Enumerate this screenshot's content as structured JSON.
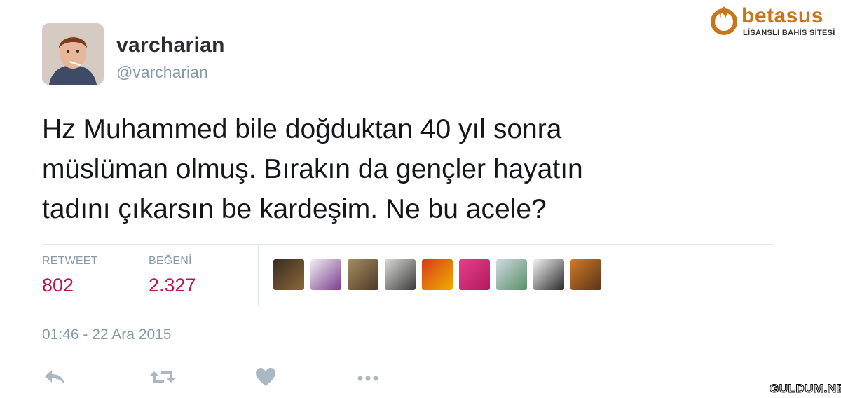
{
  "user": {
    "display_name": "varcharian",
    "handle": "@varcharian"
  },
  "tweet": {
    "lines": [
      "Hz Muhammed bile doğduktan 40 yıl sonra",
      "müslüman olmuş. Bırakın da gençler hayatın",
      "tadını çıkarsın be kardeşim. Ne bu acele?"
    ],
    "timestamp": "01:46 - 22 Ara 2015"
  },
  "stats": {
    "retweet_label": "RETWEET",
    "retweet_count": "802",
    "like_label": "BEĞENİ",
    "like_count": "2.327"
  },
  "likers": [
    {
      "name": "liker-avatar-1",
      "colors": [
        "#3a2b1f",
        "#8a6a3c"
      ]
    },
    {
      "name": "liker-avatar-2",
      "colors": [
        "#f1eff2",
        "#7a3b8c"
      ]
    },
    {
      "name": "liker-avatar-3",
      "colors": [
        "#a58c62",
        "#4d3a26"
      ]
    },
    {
      "name": "liker-avatar-4",
      "colors": [
        "#d9d9d4",
        "#3c3c3a"
      ]
    },
    {
      "name": "liker-avatar-5",
      "colors": [
        "#d63a1a",
        "#f0b000"
      ]
    },
    {
      "name": "liker-avatar-6",
      "colors": [
        "#e83e8c",
        "#b11a5c"
      ]
    },
    {
      "name": "liker-avatar-7",
      "colors": [
        "#cfd9de",
        "#5a8f6a"
      ]
    },
    {
      "name": "liker-avatar-8",
      "colors": [
        "#f2f2f2",
        "#2a2a2a"
      ]
    },
    {
      "name": "liker-avatar-9",
      "colors": [
        "#d07a2a",
        "#5a3416"
      ]
    }
  ],
  "actions": {
    "icons": [
      "reply-icon",
      "retweet-icon",
      "like-icon",
      "more-icon"
    ]
  },
  "colors": {
    "stat_value": "#c0134a",
    "muted": "#8899a6",
    "brand": "#c8751c"
  },
  "branding": {
    "logo_text": "betasus",
    "tagline": "LİSANSLI BAHİS SİTESİ",
    "watermark": "GULDUM.NET"
  }
}
